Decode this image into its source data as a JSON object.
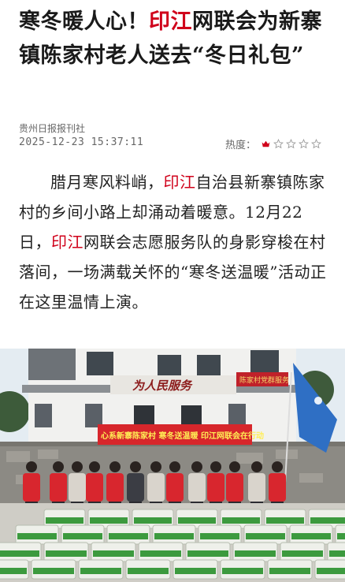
{
  "article": {
    "title_part1": "寒冬暖人心！",
    "title_highlight": "印江",
    "title_part2": "网联会为新寨镇陈家村老人送去“冬日礼包”",
    "source": "贵州日报报刊社",
    "timestamp": "2025-12-23 15:37:11",
    "heat_label": "热度：",
    "heat_rating": 1,
    "heat_max": 5,
    "body_p1_a": "腊月寒风料峭，",
    "body_p1_hl1": "印江",
    "body_p1_b": "自治县新寨镇陈家村的乡间小路上却涌动着暖意。12月22日，",
    "body_p1_hl2": "印江",
    "body_p1_c": "网联会志愿服务队的身影穿梭在村落间，一场满载关怀的“寒冬送温暖”活动正在这里温情上演。"
  },
  "photo": {
    "banner_text": "心系新寨陈家村 寒冬送温暖 印江网联会在行动",
    "building_sign": "为人民服务",
    "party_sign": "陈家村党群服务",
    "colors": {
      "accent": "#d0021b",
      "banner": "#d7262b",
      "vest": "#d8262e",
      "flag": "#2f6fc4",
      "sky": "#e4ecf2"
    }
  }
}
